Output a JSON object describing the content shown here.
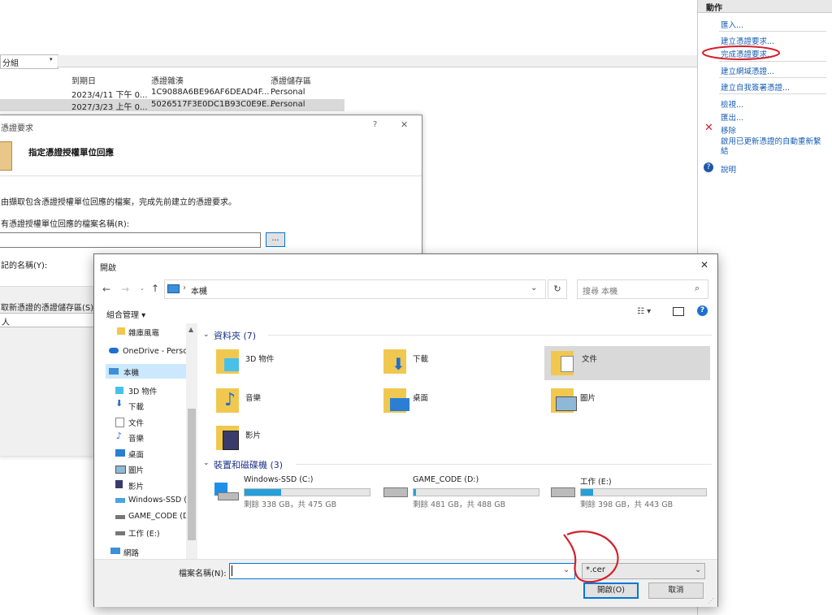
{
  "actions": {
    "header": "動作",
    "items": [
      "匯入...",
      "建立憑證要求...",
      "完成憑證要求...",
      "建立網域憑證...",
      "建立自我簽署憑證...",
      "檢視...",
      "匯出...",
      "移除",
      "啟用已更新憑證的自動重新繫結",
      "說明"
    ]
  },
  "background": {
    "group_label": "分組",
    "columns": [
      "到期日",
      "憑證雜湊",
      "憑證儲存區"
    ],
    "rows": [
      {
        "expiry": "2023/4/11 下午 0...",
        "hash": "1C9088A6BE96AF6DEAD4F...",
        "store": "Personal"
      },
      {
        "expiry": "2027/3/23 上午 0...",
        "hash": "5026517F3E0DC1B93C0E9E...",
        "store": "Personal"
      }
    ]
  },
  "wizard": {
    "title": "憑證要求",
    "help": "?",
    "close": "✕",
    "heading": "指定憑證授權單位回應",
    "description": "由擷取包含憑證授權單位回應的檔案，完成先前建立的憑證要求。",
    "file_label": "有憑證授權單位回應的檔案名稱(R):",
    "browse": "...",
    "friendly_label": "記的名稱(Y):",
    "store_label": "取新憑證的憑證儲存區(S):",
    "store_value": "人"
  },
  "open_dialog": {
    "title": "開啟",
    "close": "✕",
    "path": "本機",
    "search_placeholder": "搜尋 本機",
    "organize": "組合管理 ▾",
    "nav": [
      "雜庫風竈",
      "OneDrive - Perso",
      "本機",
      "3D 物件",
      "下載",
      "文件",
      "音樂",
      "桌面",
      "圖片",
      "影片",
      "Windows-SSD (",
      "GAME_CODE (D",
      "工作 (E:)",
      "網路"
    ],
    "folders_title": "資料夾 (7)",
    "folders": [
      "3D 物件",
      "下載",
      "文件",
      "音樂",
      "桌面",
      "圖片",
      "影片"
    ],
    "drives_title": "裝置和磁碟機 (3)",
    "drives": [
      {
        "name": "Windows-SSD (C:)",
        "free": "剩餘 338 GB，共 475 GB",
        "used": 0.29
      },
      {
        "name": "GAME_CODE (D:)",
        "free": "剩餘 481 GB，共 488 GB",
        "used": 0.015
      },
      {
        "name": "工作 (E:)",
        "free": "剩餘 398 GB，共 443 GB",
        "used": 0.1
      }
    ],
    "filename_label": "檔案名稱(N):",
    "filename_value": "",
    "filter_value": "*.cer",
    "open_button": "開啟(O)",
    "cancel_button": "取消"
  },
  "colors": {
    "accent": "#1a5fb4",
    "annotation": "#d4202a",
    "drive_fill": "#26a0da"
  }
}
